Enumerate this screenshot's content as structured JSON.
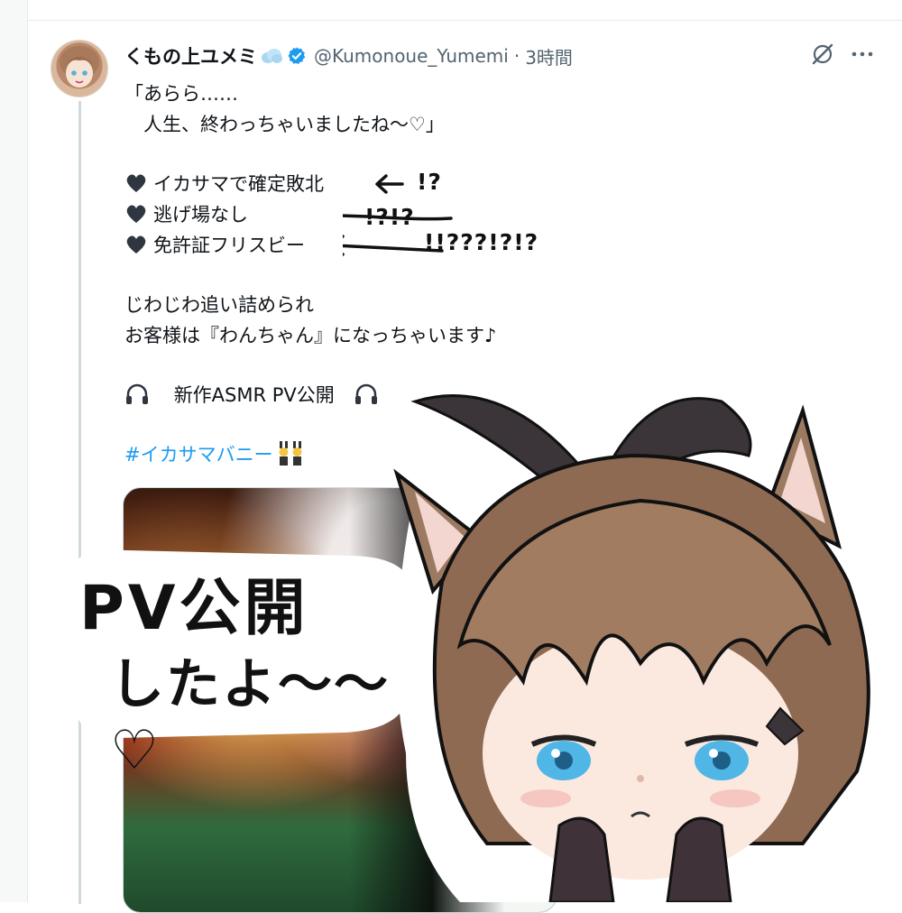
{
  "tweet": {
    "display_name": "くもの上ユメミ",
    "handle": "@Kumonoue_Yumemi",
    "separator": "·",
    "timestamp": "3時間",
    "lines": {
      "quote_1": "「あらら……",
      "quote_2": "　人生、終わっちゃいましたね〜♡」",
      "bullet_1": "イカサマで確定敗北",
      "bullet_2": "逃げ場なし",
      "bullet_3": "免許証フリスビー",
      "line_4": "じわじわ追い詰められ",
      "line_5": "お客様は『わんちゃん』になっちゃいます♪",
      "announcement": "新作ASMR PV公開",
      "hashtag": "#イカサマバニー"
    },
    "annotations": {
      "a1": "!?",
      "a2": "!?!?",
      "a3": "!!???!?!?"
    }
  },
  "overlay": {
    "handwritten_line_1": "PV公開",
    "handwritten_line_2": "したよ〜〜♡"
  },
  "colors": {
    "accent": "#1d9bf0",
    "text": "#0f1419",
    "muted": "#536471",
    "heart": "#2f3640"
  },
  "icons": {
    "verified": "verified-badge-icon",
    "grok": "grok-icon",
    "more": "more-icon",
    "bullet": "black-heart-icon",
    "headphones": "headphones-icon"
  }
}
